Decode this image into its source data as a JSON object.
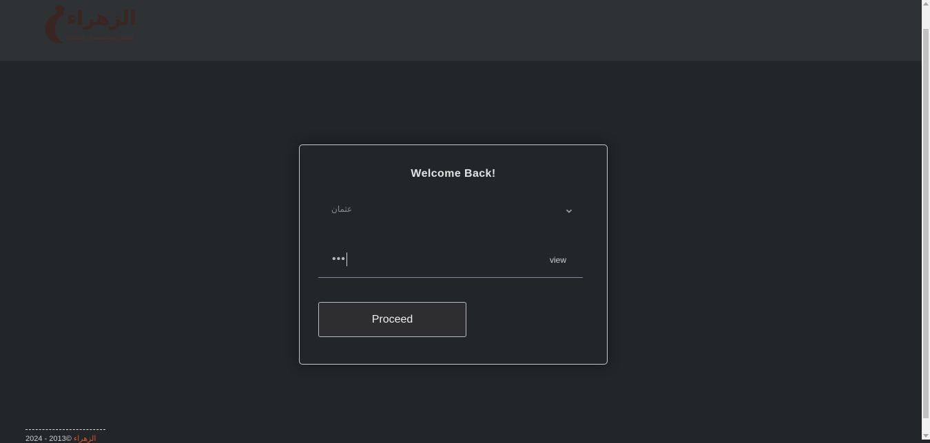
{
  "header": {
    "logo": {
      "brand_name": "الزهراء",
      "tagline": "للعطور ومستحضرات التجميل"
    }
  },
  "login_card": {
    "title": "Welcome Back!",
    "user_select": {
      "selected_value": "عثمان"
    },
    "password_field": {
      "masked_value": "•••",
      "view_label": "view"
    },
    "proceed_label": "Proceed"
  },
  "footer": {
    "copyright_text": "2024 - 2013©",
    "brand_text": "الزهراء"
  },
  "colors": {
    "background": "#232628",
    "header_background": "#2f3234",
    "card_border": "#c9c9c9",
    "input_underline": "#8b86a6",
    "brand_accent": "#d25a2a"
  },
  "icons": {
    "select_chevron": "chevron-down-icon",
    "logo_mark": "bottle-icon"
  }
}
